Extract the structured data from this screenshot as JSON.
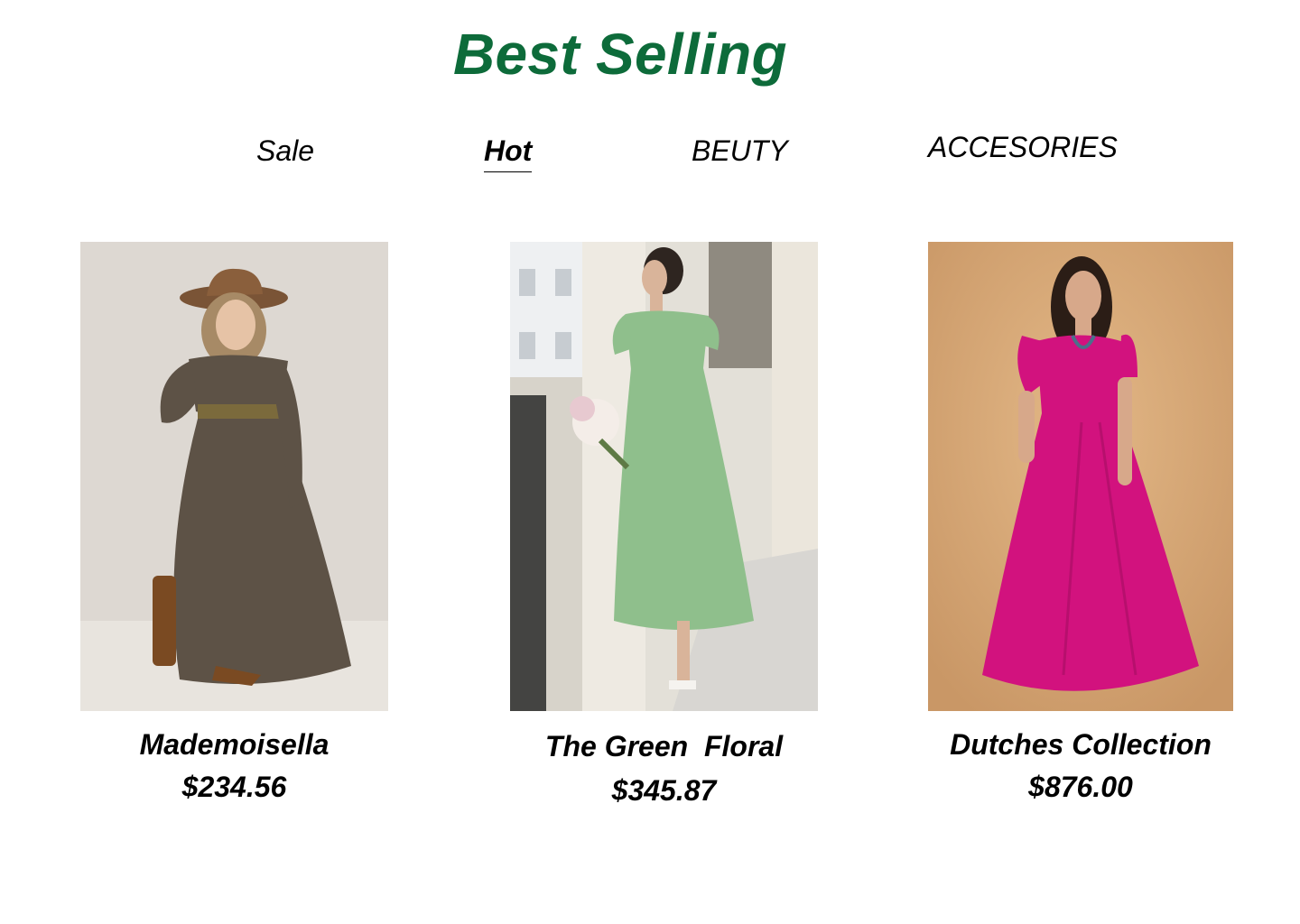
{
  "section": {
    "title": "Best Selling",
    "title_color": "#0d6b3a"
  },
  "tabs": [
    {
      "label": "Sale",
      "active": false
    },
    {
      "label": "Hot",
      "active": true
    },
    {
      "label": "BEUTY",
      "active": false
    },
    {
      "label": "ACCESORIES",
      "active": false
    }
  ],
  "products": [
    {
      "name": "Mademoisella",
      "price": "$234.56",
      "image": "woman-in-floral-boho-dress-photo",
      "dress_color": "#5d5246",
      "bg_color": "#ddd8d2"
    },
    {
      "name": "The Green  Floral",
      "price": "$345.87",
      "image": "woman-in-green-floral-dress-photo",
      "dress_color": "#8fbf8c",
      "bg_color": "#e3e0d8"
    },
    {
      "name": "Dutches Collection",
      "price": "$876.00",
      "image": "woman-in-magenta-gown-photo",
      "dress_color": "#d2127e",
      "bg_color": "#d7a877"
    }
  ]
}
